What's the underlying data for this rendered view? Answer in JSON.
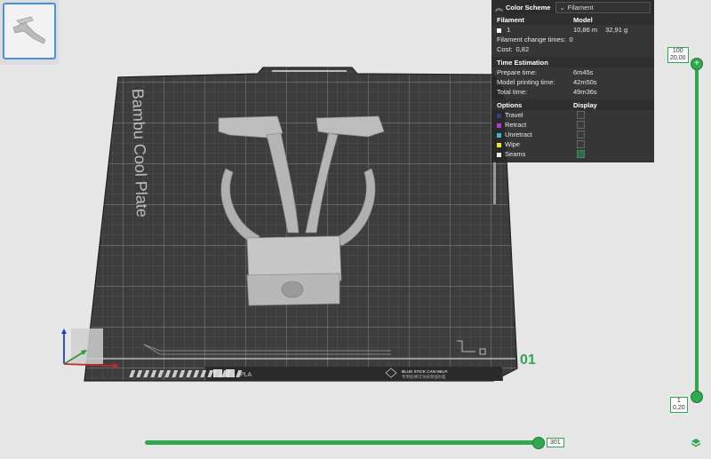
{
  "plate": {
    "brand_text": "Bambu Cool Plate",
    "plate_number": "01",
    "footer_material": "PLA",
    "footer_note_line1": "BLUE STICK CAN HELP.",
    "footer_note_line2": "专用胶棒可涂抹增强附着"
  },
  "color_scheme": {
    "title": "Color Scheme",
    "selected": "Filament"
  },
  "filament_table": {
    "col_filament": "Filament",
    "col_model": "Model",
    "row_index": "1",
    "row_length": "10,86 m",
    "row_weight": "32,91 g",
    "change_times_label": "Filament change times:",
    "change_times_value": "0",
    "cost_label": "Cost:",
    "cost_value": "0,82"
  },
  "time_estimation": {
    "title": "Time Estimation",
    "prepare_label": "Prepare time:",
    "prepare_value": "6m45s",
    "model_label": "Model printing time:",
    "model_value": "42m50s",
    "total_label": "Total time:",
    "total_value": "49m36s"
  },
  "options": {
    "col_options": "Options",
    "col_display": "Display",
    "items": [
      {
        "label": "Travel",
        "color": "#3a3a8c",
        "display": false
      },
      {
        "label": "Retract",
        "color": "#b03ad6",
        "display": false
      },
      {
        "label": "Unretract",
        "color": "#3ab6d6",
        "display": false
      },
      {
        "label": "Wipe",
        "color": "#f2e61a",
        "display": false
      },
      {
        "label": "Seams",
        "color": "#f0f0f0",
        "display": true
      }
    ]
  },
  "layer_slider": {
    "top_layer": "100",
    "top_height": "20,00",
    "bottom_layer": "1",
    "bottom_height": "0,20"
  },
  "move_slider": {
    "value": "301"
  },
  "accent_color": "#2fa84f"
}
